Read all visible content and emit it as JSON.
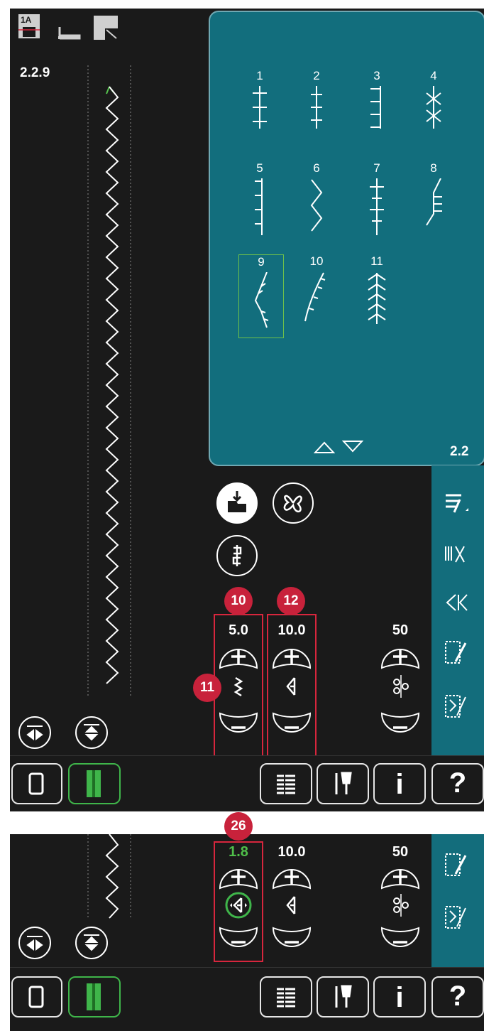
{
  "screen1": {
    "foot_label": "1A",
    "stitch_id": "2.2.9",
    "page_label": "2.2",
    "stitches": [
      {
        "num": "1"
      },
      {
        "num": "2"
      },
      {
        "num": "3"
      },
      {
        "num": "4"
      },
      {
        "num": "5"
      },
      {
        "num": "6"
      },
      {
        "num": "7"
      },
      {
        "num": "8"
      },
      {
        "num": "9"
      },
      {
        "num": "10"
      },
      {
        "num": "11"
      }
    ],
    "selected_stitch": "9",
    "param_width": "5.0",
    "param_density": "10.0",
    "param_tension": "50",
    "badges": {
      "b10": "10",
      "b11": "11",
      "b12": "12"
    },
    "help_label": "?",
    "info_label": "i"
  },
  "screen2": {
    "badge": "26",
    "param_width": "1.8",
    "param_density": "10.0",
    "param_tension": "50",
    "help_label": "?",
    "info_label": "i"
  },
  "colors": {
    "accent_green": "#3fb54a",
    "highlight": "#d7263d",
    "teal": "#126e7d"
  }
}
